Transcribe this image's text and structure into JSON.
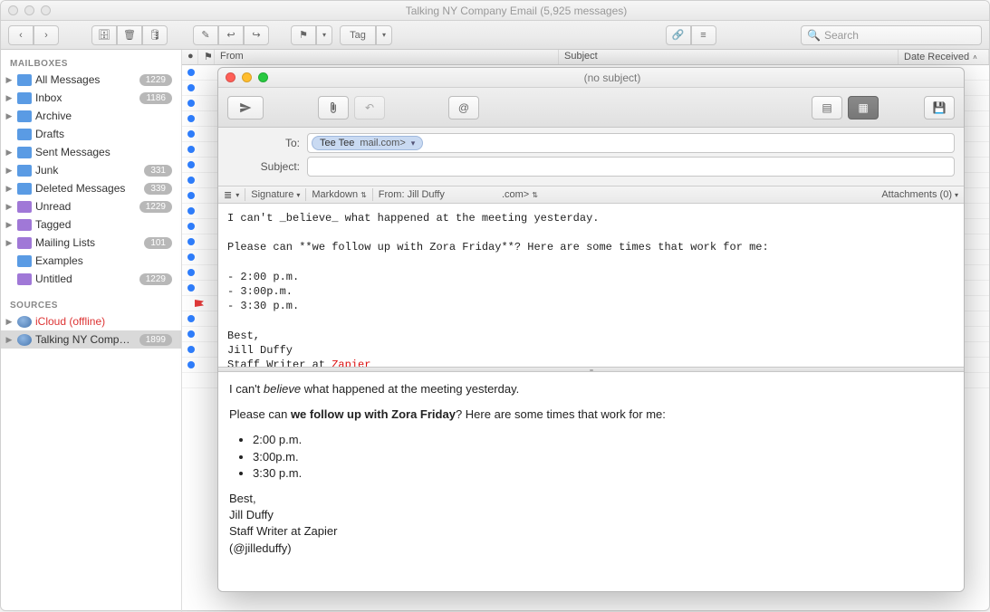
{
  "main": {
    "title": "Talking NY Company Email (5,925 messages)",
    "search_placeholder": "Search",
    "tag_label": "Tag"
  },
  "sidebar": {
    "header_mailboxes": "MAILBOXES",
    "header_sources": "SOURCES",
    "items": [
      {
        "label": "All Messages",
        "count": "1229",
        "icon": "blue"
      },
      {
        "label": "Inbox",
        "count": "1186",
        "icon": "blue"
      },
      {
        "label": "Archive",
        "count": "",
        "icon": "blue"
      },
      {
        "label": "Drafts",
        "count": "",
        "icon": "blue"
      },
      {
        "label": "Sent Messages",
        "count": "",
        "icon": "blue"
      },
      {
        "label": "Junk",
        "count": "331",
        "icon": "blue"
      },
      {
        "label": "Deleted Messages",
        "count": "339",
        "icon": "blue"
      },
      {
        "label": "Unread",
        "count": "1229",
        "icon": "purple"
      },
      {
        "label": "Tagged",
        "count": "",
        "icon": "purple"
      },
      {
        "label": "Mailing Lists",
        "count": "101",
        "icon": "purple"
      },
      {
        "label": "Examples",
        "count": "",
        "icon": "blue"
      },
      {
        "label": "Untitled",
        "count": "1229",
        "icon": "purple"
      }
    ],
    "sources": [
      {
        "label": "iCloud (offline)",
        "count": "",
        "offline": true
      },
      {
        "label": "Talking NY Company…",
        "count": "1899",
        "selected": true
      }
    ]
  },
  "msglist": {
    "from_col": "From",
    "subject_col": "Subject",
    "date_col": "Date Received"
  },
  "compose": {
    "title": "(no subject)",
    "to_label": "To:",
    "subject_label": "Subject:",
    "recipient_name": "Tee Tee",
    "recipient_domain": "mail.com>",
    "signature_label": "Signature",
    "markdown_label": "Markdown",
    "from_label": "From: Jill Duffy",
    "from_domain": ".com>",
    "attachments_label": "Attachments (0)",
    "editor_lines": {
      "l1a": "I can't _believe_ what happened at the meeting yesterday.",
      "l2": "Please can **we follow up with Zora Friday**? Here are some times that work for me:",
      "l3": "- 2:00 p.m.",
      "l4": "- 3:00p.m.",
      "l5": "- 3:30 p.m.",
      "l6": "Best,",
      "l7": "Jill Duffy",
      "l8a": "Staff Writer at ",
      "l8b": "Zapier",
      "l9": "(@jilleduffy)"
    },
    "preview": {
      "p1a": "I can't ",
      "p1b": "believe",
      "p1c": " what happened at the meeting yesterday.",
      "p2a": "Please can ",
      "p2b": "we follow up with Zora Friday",
      "p2c": "? Here are some times that work for me:",
      "li1": "2:00 p.m.",
      "li2": "3:00p.m.",
      "li3": "3:30 p.m.",
      "s1": "Best,",
      "s2": "Jill Duffy",
      "s3": "Staff Writer at Zapier",
      "s4": "(@jilleduffy)"
    }
  }
}
